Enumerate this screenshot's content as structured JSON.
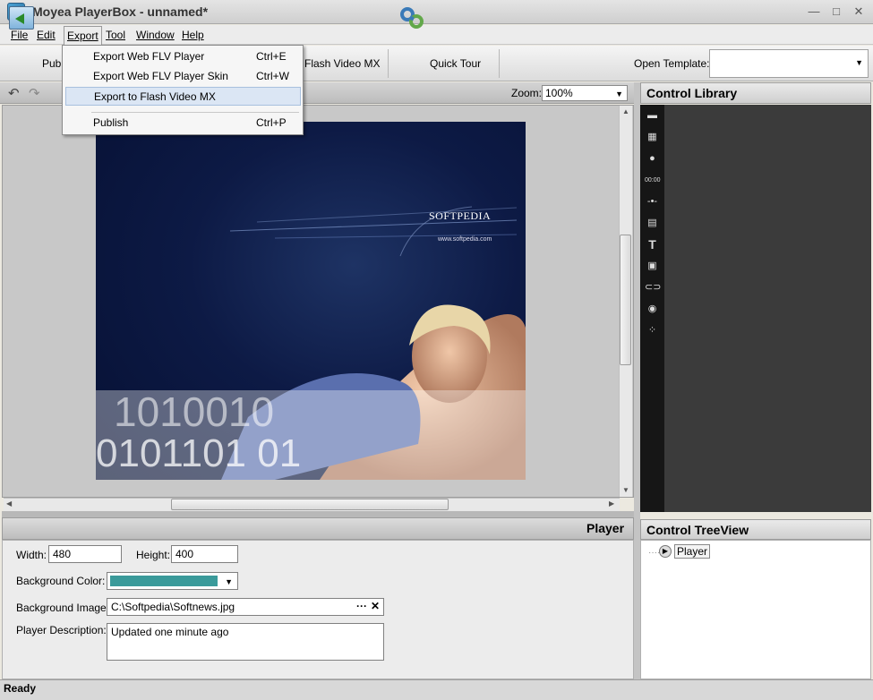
{
  "window": {
    "title": "Moyea PlayerBox - unnamed*",
    "minimize": "—",
    "maximize": "□",
    "close": "✕"
  },
  "menubar": {
    "items": [
      "File",
      "Edit",
      "Export",
      "Tool",
      "Window",
      "Help"
    ]
  },
  "export_menu": {
    "items": [
      {
        "label": "Export Web FLV Player",
        "shortcut": "Ctrl+E"
      },
      {
        "label": "Export Web FLV Player Skin",
        "shortcut": "Ctrl+W"
      },
      {
        "label": "Export to Flash Video MX",
        "shortcut": ""
      },
      {
        "label": "Publish",
        "shortcut": "Ctrl+P"
      }
    ]
  },
  "toolbar": {
    "publish_label": "Publi",
    "flash_label": "Flash Video MX",
    "tour_label": "Quick Tour",
    "template_label": "Open Template:",
    "template_value": ""
  },
  "canvas": {
    "zoom_label": "Zoom:",
    "zoom_value": "100%"
  },
  "image_text": {
    "brand": "SOFTPEDIA",
    "url": "www.softpedia.com"
  },
  "library": {
    "title": "Control Library"
  },
  "properties": {
    "title": "Player",
    "width_label": "Width:",
    "width_value": "480",
    "height_label": "Height:",
    "height_value": "400",
    "bgcolor_label": "Background Color:",
    "bgcolor_value": "#3a9a9a",
    "bgimage_label": "Background Image:",
    "bgimage_value": "C:\\Softpedia\\Softnews.jpg",
    "desc_label": "Player Description:",
    "desc_value": "Updated one minute ago"
  },
  "tree": {
    "title": "Control TreeView",
    "node": "Player"
  },
  "status": {
    "text": "Ready"
  }
}
